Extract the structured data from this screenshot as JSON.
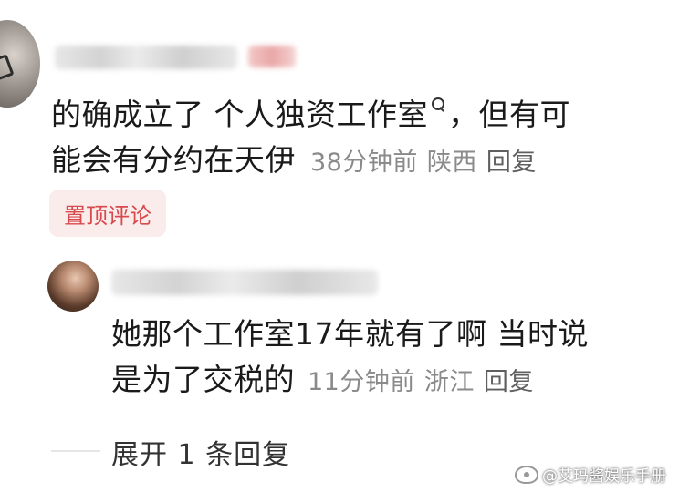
{
  "main_comment": {
    "text_line1_prefix": "的确成立了 ",
    "hashtag": "个人独资工作室",
    "text_line1_suffix": "，但有可",
    "text_line2": "能会有分约在天伊",
    "time": "38分钟前",
    "location": "陕西",
    "reply_label": "回复",
    "pinned_label": "置顶评论"
  },
  "reply_comment": {
    "text_line1": "她那个工作室17年就有了啊 当时说",
    "text_line2": "是为了交税的",
    "time": "11分钟前",
    "location": "浙江",
    "reply_label": "回复"
  },
  "expand_label": "展开 1 条回复",
  "watermark": "@艾玛酱娱乐手册"
}
